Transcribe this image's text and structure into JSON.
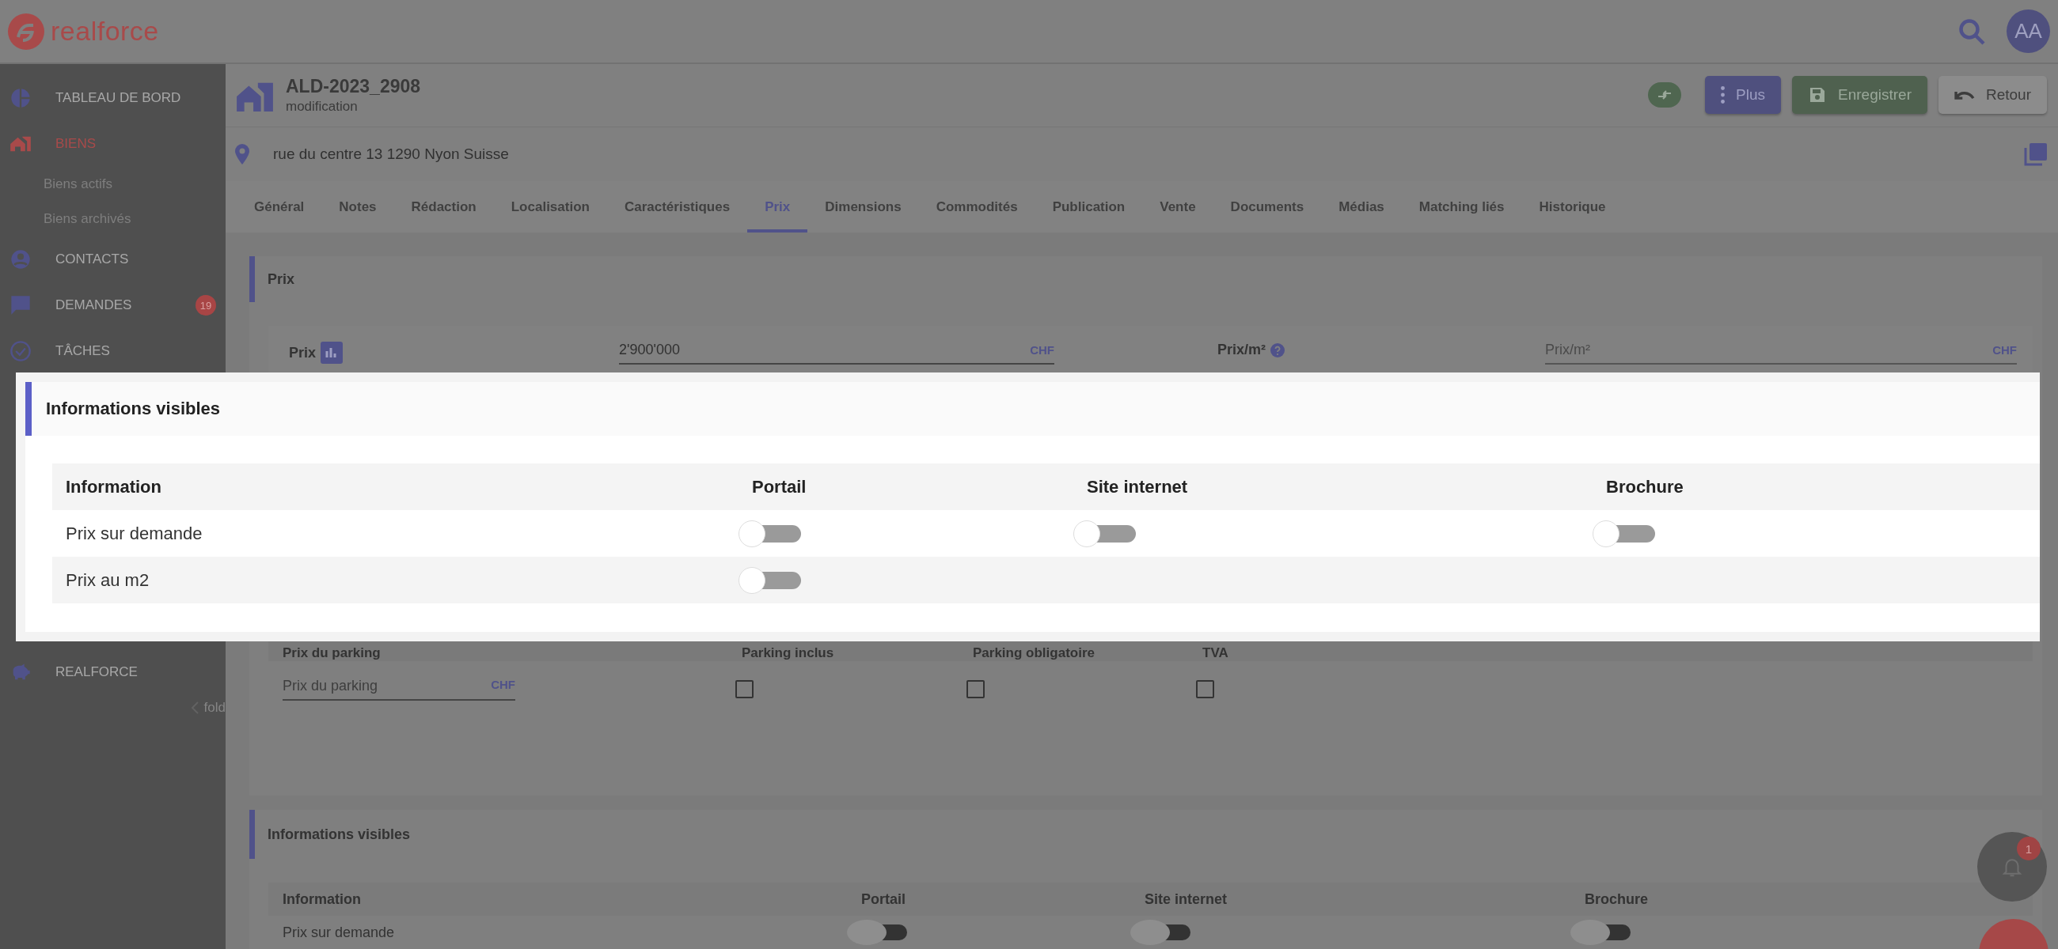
{
  "header": {
    "logo_text": "realforce",
    "avatar": "AA"
  },
  "sidebar": {
    "items": [
      {
        "label": "TABLEAU DE BORD",
        "kind": "dashboard",
        "selected": false
      },
      {
        "label": "BIENS",
        "kind": "house",
        "selected": true,
        "children": [
          {
            "label": "Biens actifs"
          },
          {
            "label": "Biens archivés"
          }
        ]
      },
      {
        "label": "CONTACTS",
        "kind": "person",
        "selected": false
      },
      {
        "label": "DEMANDES",
        "kind": "chat",
        "selected": false,
        "badge": "19"
      },
      {
        "label": "TÂCHES",
        "kind": "check",
        "selected": false
      }
    ],
    "bottom_items": [
      {
        "label": "REALFORCE",
        "kind": "piggy",
        "selected": false
      }
    ],
    "fold": "fold"
  },
  "property": {
    "title": "ALD-2023_2908",
    "subtitle": "modification",
    "address": "rue du centre 13 1290 Nyon Suisse",
    "buttons": [
      {
        "kind": "swap"
      },
      {
        "kind": "more",
        "label": "Plus"
      },
      {
        "kind": "save",
        "label": "Enregistrer"
      },
      {
        "kind": "back",
        "label": "Retour"
      }
    ]
  },
  "tabs": [
    {
      "label": "Général",
      "selected": false
    },
    {
      "label": "Notes",
      "selected": false
    },
    {
      "label": "Rédaction",
      "selected": false
    },
    {
      "label": "Localisation",
      "selected": false
    },
    {
      "label": "Caractéristiques",
      "selected": false
    },
    {
      "label": "Prix",
      "selected": true
    },
    {
      "label": "Dimensions",
      "selected": false
    },
    {
      "label": "Commodités",
      "selected": false
    },
    {
      "label": "Publication",
      "selected": false
    },
    {
      "label": "Vente",
      "selected": false
    },
    {
      "label": "Documents",
      "selected": false
    },
    {
      "label": "Médias",
      "selected": false
    },
    {
      "label": "Matching liés",
      "selected": false
    },
    {
      "label": "Historique",
      "selected": false
    }
  ],
  "price_section": {
    "title": "Prix",
    "price_label": "Prix",
    "price_value": "2'900'000",
    "price_currency": "CHF",
    "per_m2_label": "Prix/m²",
    "per_m2_placeholder": "Prix/m²",
    "per_m2_currency": "CHF",
    "parking": {
      "columns": [
        "Prix du parking",
        "Parking inclus",
        "Parking obligatoire",
        "TVA"
      ],
      "placeholder": "Prix du parking",
      "currency": "CHF",
      "checkboxes": [
        {
          "checked": false
        },
        {
          "checked": false
        },
        {
          "checked": false
        }
      ]
    }
  },
  "visible_section": {
    "title": "Informations visibles",
    "columns": [
      "Information",
      "Portail",
      "Site internet",
      "Brochure"
    ],
    "rows": [
      {
        "label": "Prix sur demande",
        "toggles": [
          {
            "on": false
          },
          {
            "on": false
          },
          {
            "on": false
          }
        ]
      }
    ]
  },
  "notifications": {
    "badge": "1"
  },
  "dialog": {
    "title": "Informations visibles",
    "columns": [
      "Information",
      "Portail",
      "Site internet",
      "Brochure"
    ],
    "rows": [
      {
        "label": "Prix sur demande",
        "toggles": [
          {
            "on": false
          },
          {
            "on": false
          },
          {
            "on": false
          }
        ]
      },
      {
        "label": "Prix au m2",
        "toggles": [
          {
            "on": false
          }
        ]
      }
    ]
  }
}
